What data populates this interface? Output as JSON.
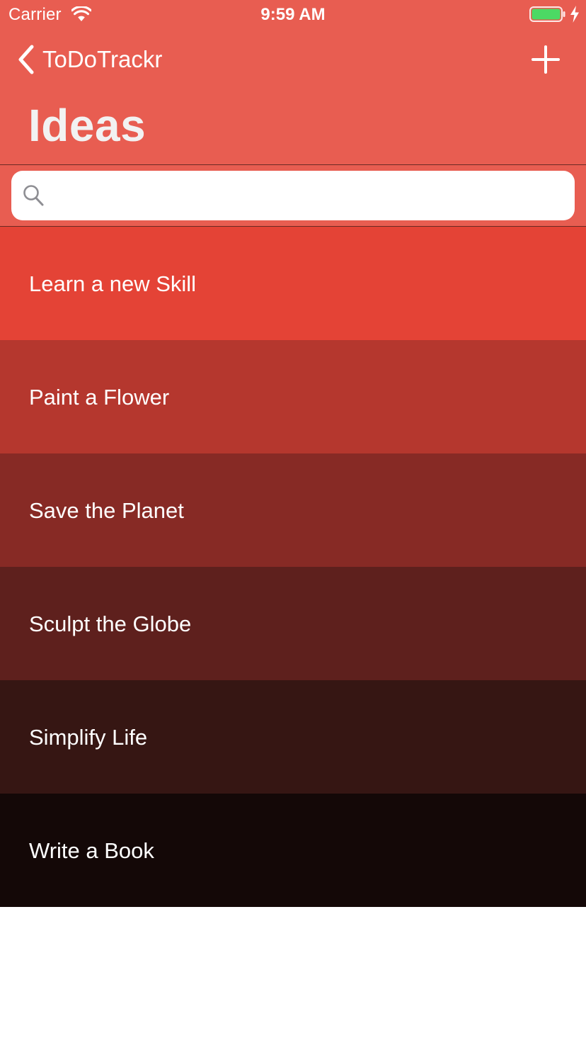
{
  "status_bar": {
    "carrier": "Carrier",
    "time": "9:59 AM",
    "icons": [
      "wifi-icon",
      "battery-icon",
      "charging-icon"
    ],
    "battery_color": "#4cd964"
  },
  "nav": {
    "back_label": "ToDoTrackr",
    "back_icon": "chevron-left-icon",
    "add_icon": "plus-icon",
    "title": "Ideas",
    "bar_color": "#e85d51"
  },
  "search": {
    "placeholder": "",
    "value": "",
    "icon": "search-icon"
  },
  "items": [
    {
      "label": "Learn a new Skill",
      "color": "#e44336"
    },
    {
      "label": "Paint a Flower",
      "color": "#b5372e"
    },
    {
      "label": "Save the Planet",
      "color": "#872a25"
    },
    {
      "label": "Sculpt the Globe",
      "color": "#5e201d"
    },
    {
      "label": "Simplify Life",
      "color": "#361613"
    },
    {
      "label": "Write a Book",
      "color": "#140807"
    }
  ]
}
